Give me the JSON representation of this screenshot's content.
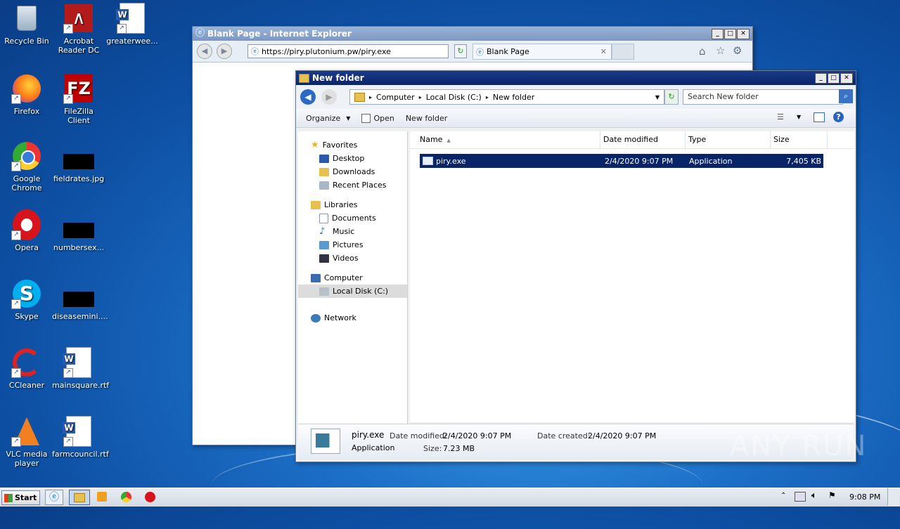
{
  "desktop": {
    "icons": [
      {
        "label": "Recycle Bin",
        "icon": "recycle-bin-icon"
      },
      {
        "label": "Acrobat Reader DC",
        "icon": "acrobat-icon"
      },
      {
        "label": "greaterwee...",
        "icon": "word-doc-icon"
      },
      {
        "label": "Firefox",
        "icon": "firefox-icon"
      },
      {
        "label": "FileZilla Client",
        "icon": "filezilla-icon"
      },
      {
        "label": "Google Chrome",
        "icon": "chrome-icon"
      },
      {
        "label": "fieldrates.jpg",
        "icon": "image-file-icon"
      },
      {
        "label": "Opera",
        "icon": "opera-icon"
      },
      {
        "label": "numbersex...",
        "icon": "image-file-icon"
      },
      {
        "label": "Skype",
        "icon": "skype-icon"
      },
      {
        "label": "diseasemini....",
        "icon": "image-file-icon"
      },
      {
        "label": "CCleaner",
        "icon": "ccleaner-icon"
      },
      {
        "label": "mainsquare.rtf",
        "icon": "word-doc-icon"
      },
      {
        "label": "VLC media player",
        "icon": "vlc-icon"
      },
      {
        "label": "farmcouncil.rtf",
        "icon": "word-doc-icon"
      }
    ]
  },
  "ie": {
    "title": "Blank Page - Internet Explorer",
    "url": "https://piry.plutonium.pw/piry.exe",
    "tab_label": "Blank Page"
  },
  "explorer": {
    "title": "New folder",
    "breadcrumb": [
      "Computer",
      "Local Disk (C:)",
      "New folder"
    ],
    "search_placeholder": "Search New folder",
    "toolbar": {
      "organize": "Organize",
      "open": "Open",
      "new_folder": "New folder"
    },
    "nav": {
      "favorites": "Favorites",
      "desktop": "Desktop",
      "downloads": "Downloads",
      "recent": "Recent Places",
      "libraries": "Libraries",
      "documents": "Documents",
      "music": "Music",
      "pictures": "Pictures",
      "videos": "Videos",
      "computer": "Computer",
      "local_disk": "Local Disk (C:)",
      "network": "Network"
    },
    "columns": {
      "name": "Name",
      "date": "Date modified",
      "type": "Type",
      "size": "Size"
    },
    "files": [
      {
        "name": "piry.exe",
        "date": "2/4/2020 9:07 PM",
        "type": "Application",
        "size": "7,405 KB"
      }
    ],
    "details": {
      "name": "piry.exe",
      "type": "Application",
      "date_modified_label": "Date modified:",
      "date_modified": "2/4/2020 9:07 PM",
      "size_label": "Size:",
      "size": "7.23 MB",
      "date_created_label": "Date created:",
      "date_created": "2/4/2020 9:07 PM"
    }
  },
  "taskbar": {
    "start": "Start",
    "clock": "9:08 PM"
  },
  "watermark": "ANY RUN",
  "colors": {
    "selection": "#0a246a",
    "title_active": "#0a246a",
    "title_inactive": "#7a96c0"
  }
}
